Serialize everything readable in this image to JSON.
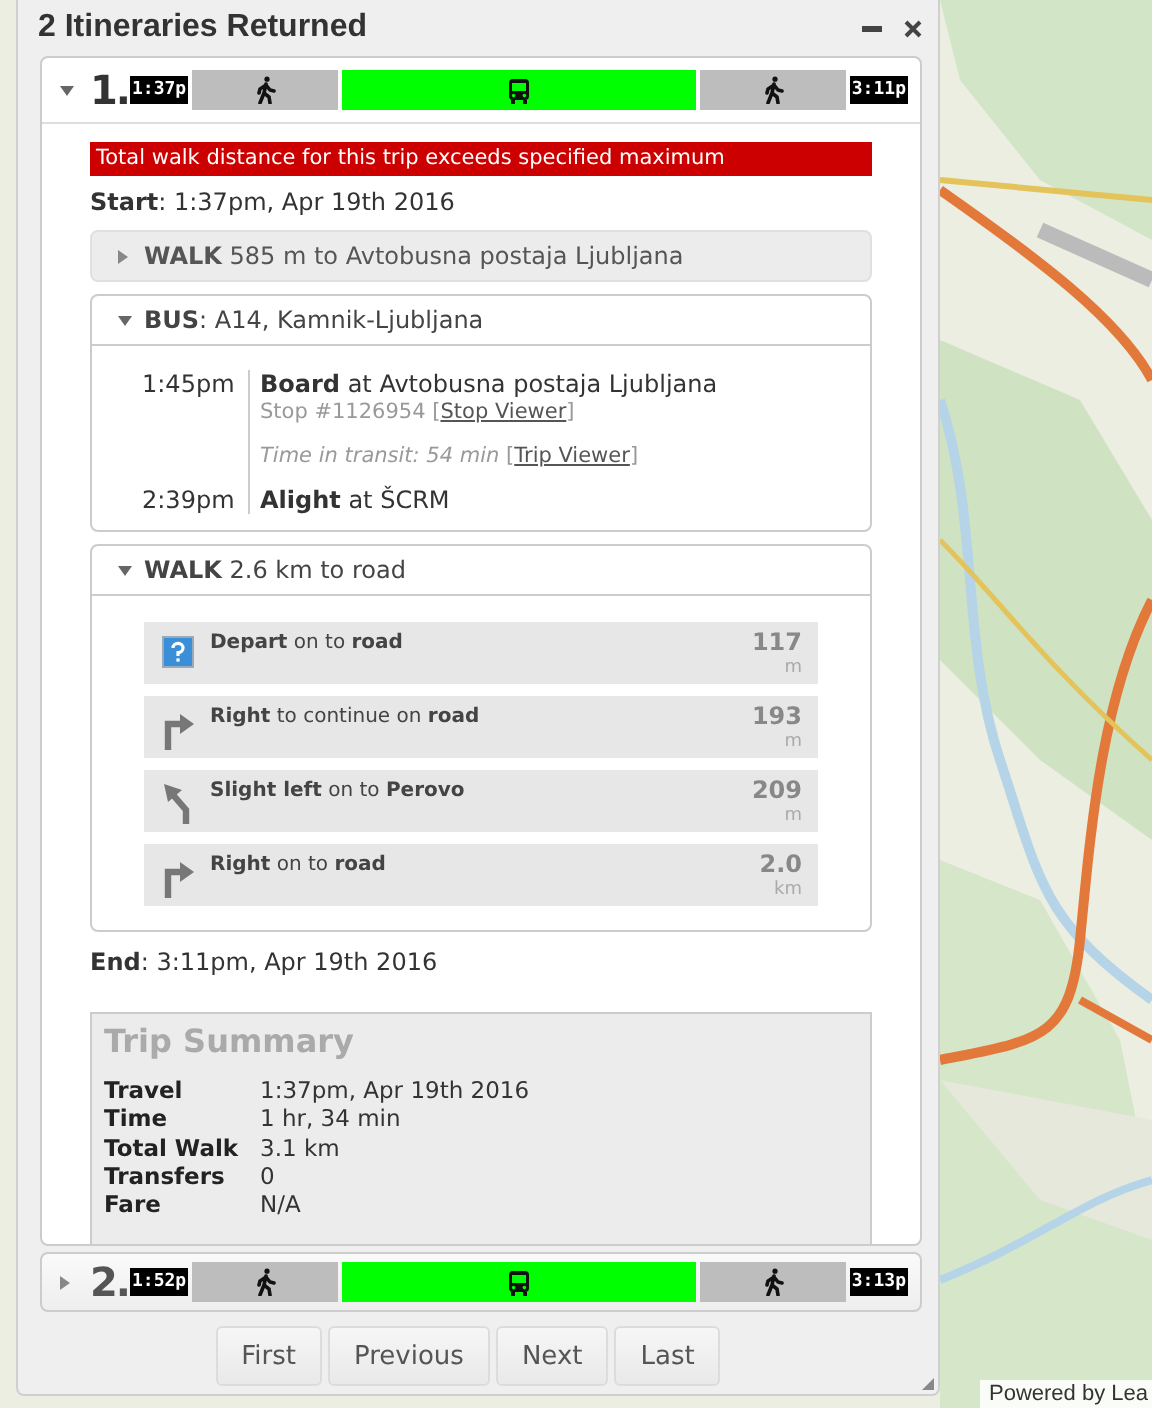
{
  "panel": {
    "title": "2 Itineraries Returned"
  },
  "itineraries": [
    {
      "number": "1.",
      "expanded": true,
      "start_time": "1:37p",
      "end_time": "3:11p",
      "segments": [
        {
          "kind": "walk"
        },
        {
          "kind": "bus"
        },
        {
          "kind": "walk"
        }
      ],
      "warning": "Total walk distance for this trip exceeds specified maximum",
      "start": "**Start**: 1:37pm, Apr 19th 2016",
      "legs": [
        {
          "kind": "walk",
          "expanded": false,
          "header": "**WALK** 585 m to Avtobusna postaja Ljubljana"
        },
        {
          "kind": "transit",
          "expanded": true,
          "header": "**BUS**: A14, Kamnik-Ljubljana",
          "board": {
            "time": "1:45pm",
            "text": "**Board** at Avtobusna postaja Ljubljana",
            "stop": "Stop #1126954",
            "stop_link": [
              "[",
              "Stop Viewer",
              "]"
            ],
            "transit": "Time in transit: 54 min",
            "trip_link": [
              "[",
              "Trip Viewer",
              "]"
            ]
          },
          "alight": {
            "time": "2:39pm",
            "text": "**Alight** at ŠCRM"
          }
        },
        {
          "kind": "walk",
          "expanded": true,
          "header": "**WALK** 2.6 km to road",
          "steps": [
            {
              "kind": "depart",
              "text": "**Depart** on to **road**",
              "distance": "117",
              "unit": "m"
            },
            {
              "kind": "right",
              "text": "**Right** to continue on **road**",
              "distance": "193",
              "unit": "m"
            },
            {
              "kind": "slight_left",
              "text": "**Slight left** on to **Perovo**",
              "distance": "209",
              "unit": "m"
            },
            {
              "kind": "right",
              "text": "**Right** on to **road**",
              "distance": "2.0",
              "unit": "km"
            }
          ]
        }
      ],
      "end": "**End**: 3:11pm, Apr 19th 2016",
      "summary": {
        "title": "Trip Summary",
        "rows": [
          {
            "label": "Travel",
            "value": "1:37pm, Apr 19th 2016"
          },
          {
            "label": "Time",
            "value": "1 hr, 34 min"
          },
          {
            "label": "Total Walk",
            "value": "3.1 km"
          },
          {
            "label": "Transfers",
            "value": "0"
          },
          {
            "label": "Fare",
            "value": "N/A"
          }
        ]
      }
    },
    {
      "number": "2.",
      "expanded": false,
      "start_time": "1:52p",
      "end_time": "3:13p",
      "segments": [
        {
          "kind": "walk"
        },
        {
          "kind": "bus"
        },
        {
          "kind": "walk"
        }
      ]
    }
  ],
  "pager": [
    "First",
    "Previous",
    "Next",
    "Last"
  ],
  "map": {
    "attribution": "Powered by Lea"
  }
}
